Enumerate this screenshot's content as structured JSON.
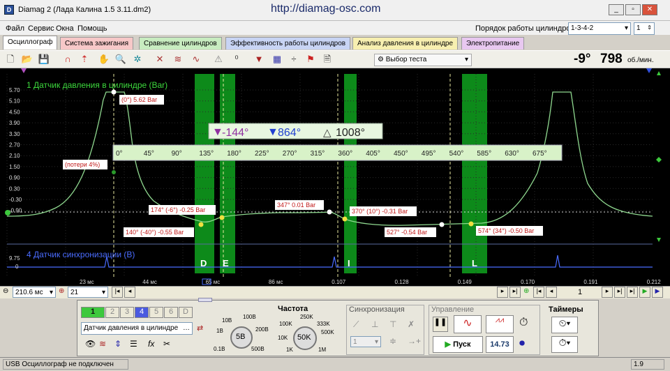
{
  "window": {
    "title": "Diamag 2 (Лада Калина 1.5 3.11.dm2)",
    "url": "http://diamag-osc.com",
    "icon": "app-logo-icon"
  },
  "menu": [
    "Файл",
    "Сервис",
    "Окна",
    "Помощь"
  ],
  "cylinder_order": {
    "label": "Порядок работы цилиндров",
    "value": "1-3-4-2",
    "count": "1"
  },
  "tabs": [
    {
      "label": "Осциллограф",
      "color": "#ffffff"
    },
    {
      "label": "Система зажигания",
      "color": "#f7c8c8"
    },
    {
      "label": "Сравнение цилиндров",
      "color": "#c8ecc0"
    },
    {
      "label": "Эффективность работы цилиндров",
      "color": "#c8d4f4"
    },
    {
      "label": "Анализ давления в цилиндре",
      "color": "#f7efb0"
    },
    {
      "label": "Электропитание",
      "color": "#e8c8f0"
    }
  ],
  "toolbar": {
    "test_select": "Выбор теста",
    "rpm_angle": "-9°",
    "rpm_value": "798",
    "rpm_unit": "об./мин."
  },
  "scope": {
    "channel1_label": "1 Датчик давления в цилиндре (Bar)",
    "channel4_label": "4 Датчик синхронизации (В)",
    "y_ticks": [
      "5.70",
      "5.10",
      "4.50",
      "3.90",
      "3.30",
      "2.70",
      "2.10",
      "1.50",
      "0.90",
      "0.30",
      "-0.30",
      "-0.90"
    ],
    "sync_ticks": [
      "9.75",
      "0"
    ],
    "time_ticks": [
      "23 мс",
      "44 мс",
      "65 мс",
      "86 мс",
      "0.107",
      "0.128",
      "0.149",
      "0.170",
      "0.191",
      "0.212"
    ],
    "angle_ticks": [
      "0°",
      "45°",
      "90°",
      "135°",
      "180°",
      "225°",
      "270°",
      "315°",
      "360°",
      "405°",
      "450°",
      "495°",
      "540°",
      "585°",
      "630°",
      "675°"
    ],
    "cursor_a": "-144°",
    "cursor_b": "864°",
    "cursor_delta": "1008°",
    "markers": [
      "(0°) 5.62 Bar",
      "(потери 4%)",
      "174° (-6°) -0.25 Bar",
      "140° (-40°) -0.55 Bar",
      "347° 0.01 Bar",
      "370° (10°) -0.31 Bar",
      "527° -0.54 Bar",
      "574° (34°) -0.50 Bar"
    ],
    "strokes": [
      "D",
      "E",
      "I",
      "L"
    ]
  },
  "bottom_controls": {
    "timebase": "210.6 мс",
    "channel_count": "21",
    "page": "1",
    "channels": [
      "1",
      "2",
      "3",
      "4",
      "5",
      "6",
      "D"
    ],
    "sensor": "Датчик давления в цилиндре",
    "volt_title": "",
    "volt_ticks": [
      "10В",
      "100В",
      "1В",
      "200В",
      "0.1В",
      "500В"
    ],
    "volt_value": "5В",
    "freq_title": "Частота",
    "freq_ticks": [
      "250K",
      "100K",
      "333K",
      "10K",
      "500K",
      "1K",
      "1M"
    ],
    "freq_value": "50K",
    "sync_title": "Синхронизация",
    "sync_channel": "1",
    "control_title": "Управление",
    "start_label": "Пуск",
    "control_value": "14.73",
    "timers_title": "Таймеры"
  },
  "status": {
    "left": "USB Осциллограф не подключен",
    "right": "1.9"
  }
}
